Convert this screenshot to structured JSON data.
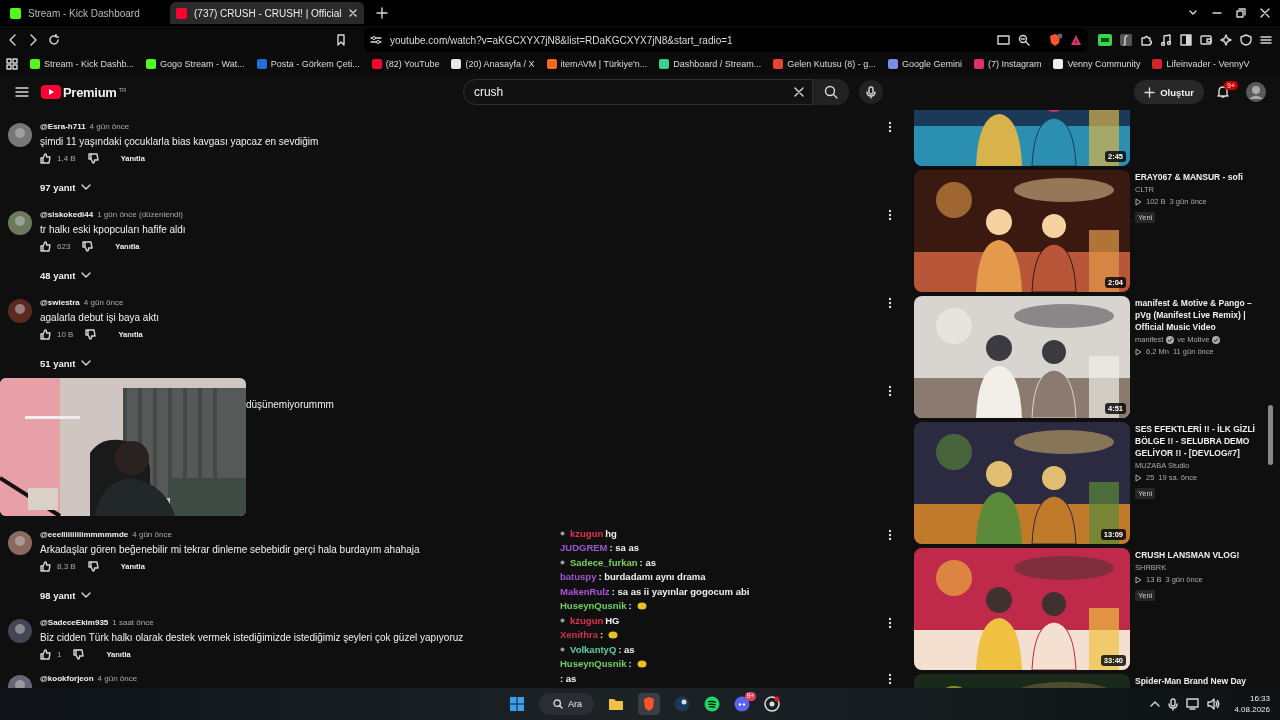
{
  "browser": {
    "tabs": [
      {
        "title": "Stream - Kick Dashboard",
        "selected": false,
        "color": "#53fc18"
      },
      {
        "title": "(737) CRUSH - CRUSH! | Official",
        "selected": true,
        "color": "#ff0033"
      }
    ],
    "url": "youtube.com/watch?v=aKGCXYX7jN8&list=RDaKGCXYX7jN8&start_radio=1",
    "bookmarks": [
      {
        "label": "Stream - Kick Dashb...",
        "color": "#53fc18"
      },
      {
        "label": "Gogo Stream - Wat...",
        "color": "#53fc18"
      },
      {
        "label": "Posta - Görkem Çeti...",
        "color": "#1e6fd9"
      },
      {
        "label": "(82) YouTube",
        "color": "#ff0033"
      },
      {
        "label": "(20) Anasayfa / X",
        "color": "#e7e7e7"
      },
      {
        "label": "itemAVM | Türkiye'n...",
        "color": "#f26a1b"
      },
      {
        "label": "Dashboard / Stream...",
        "color": "#3ccf91"
      },
      {
        "label": "Gelen Kutusu (8) - g...",
        "color": "#ea4335"
      },
      {
        "label": "Google Gemini",
        "color": "#7b8cf0"
      },
      {
        "label": "(7) Instagram",
        "color": "#e1306c"
      },
      {
        "label": "Venny Community",
        "color": "#f0f0f0"
      },
      {
        "label": "Lifeinvader - VennyV",
        "color": "#d8202a"
      }
    ]
  },
  "masthead": {
    "logo_text": "Premium",
    "region": "TR",
    "search": {
      "value": "crush"
    },
    "create": "Oluştur",
    "notifications": "9+"
  },
  "comments": [
    {
      "kind": "full",
      "author": "@Esra-h711",
      "time": "4 gün önce",
      "text": "şimdi 11 yaşındaki çocuklarla bias kavgası yapcaz en sevdiğim",
      "likes": "1,4 B",
      "reply": "Yanıtla",
      "replies": "97 yanıt"
    },
    {
      "kind": "full",
      "author": "@siskokedi44",
      "time": "1 gün önce (düzenlendi)",
      "text": "tr halkı eski kpopcuları hafife aldı",
      "likes": "623",
      "reply": "Yanıtla",
      "replies": "48 yanıt"
    },
    {
      "kind": "full",
      "author": "@swiestra",
      "time": "4 gün önce",
      "text": "agalarla debut işi baya aktı",
      "likes": "10 B",
      "reply": "Yanıtla",
      "replies": "51 yanıt"
    },
    {
      "kind": "covered",
      "text": "düşünemiyorummm"
    },
    {
      "kind": "full",
      "author": "@eeelliiiiiiiimmmmmde",
      "time": "4 gün önce",
      "text": "Arkadaşlar gören beğenebilir mi tekrar dinleme sebebidir gerçi hala burdayım ahahaja",
      "likes": "8,3 B",
      "reply": "Yanıtla",
      "replies": "98 yanıt"
    },
    {
      "kind": "full",
      "author": "@SadeceEkim935",
      "time": "1 saat önce",
      "text": "Biz cidden Türk halkı olarak destek vermek istediğimizde istediğimiz şeyleri çok güzel yapıyoruz",
      "likes": "1",
      "reply": "Yanıtla"
    },
    {
      "kind": "full",
      "author": "@kookforjeon",
      "time": "4 gün önce"
    }
  ],
  "videos": [
    {
      "duration": "2:45"
    },
    {
      "title": "ERAY067 & MANSUR - sofi",
      "channels": [
        {
          "name": "CLTR",
          "verified": false
        }
      ],
      "views": "102 B",
      "age": "3 gün önce",
      "badge": "Yeni",
      "duration": "2:04"
    },
    {
      "title": "manifest & Motive & Pango – pVg (Manifest Live Remix) | Official Music Video",
      "channels": [
        {
          "name": "manifest",
          "verified": true
        },
        {
          "name": "ve Motive",
          "verified": true
        }
      ],
      "views": "6,2 Mn",
      "age": "11 gün önce",
      "duration": "4:51"
    },
    {
      "title": "SES EFEKTLERİ !! - İLK GİZLİ BÖLGE !! -  SELUBRA DEMO GELİYOR !! -  [DEVLOG#7]",
      "channels": [
        {
          "name": "MUZABA Studio",
          "verified": false
        }
      ],
      "views": "25",
      "age": "19 sa. önce",
      "badge": "Yeni",
      "duration": "13:09"
    },
    {
      "title": "CRUSH LANSMAN VLOG!",
      "channels": [
        {
          "name": "SHRBRK",
          "verified": false
        }
      ],
      "views": "13 B",
      "age": "3 gün önce",
      "badge": "Yeni",
      "duration": "33:40"
    },
    {
      "title": "Spider-Man Brand New Day"
    }
  ],
  "chat": [
    {
      "user": "kzugun",
      "text": " hg",
      "color": "#e0304e",
      "badge": true,
      "emote": false
    },
    {
      "user": "JUDGREM",
      "text": " : sa as",
      "color": "#9b59d0",
      "badge": false,
      "emote": false
    },
    {
      "user": "Sadece_furkan",
      "text": " : as",
      "color": "#7bd35a",
      "badge": true,
      "emote": false
    },
    {
      "user": "batuspy",
      "text": " : burdadamı aynı drama",
      "color": "#9b59d0",
      "badge": false,
      "emote": false
    },
    {
      "user": "MakenRulz",
      "text": " : sa as ii yayınlar gogocum abi",
      "color": "#b14fe0",
      "badge": false,
      "emote": false
    },
    {
      "user": "HuseynQusnik",
      "text": " :",
      "color": "#6fd05a",
      "badge": false,
      "emote": true
    },
    {
      "user": "kzugun",
      "text": " HG",
      "color": "#e0304e",
      "badge": true,
      "emote": false
    },
    {
      "user": "Xenithra",
      "text": " :",
      "color": "#d0304a",
      "badge": false,
      "emote": true
    },
    {
      "user": "VolkantyQ",
      "text": " : as",
      "color": "#58d0a0",
      "badge": true,
      "emote": false
    },
    {
      "user": "HuseynQusnik",
      "text": " :",
      "color": "#6fd05a",
      "badge": false,
      "emote": true
    },
    {
      "text": ": as",
      "badge": false,
      "emote": false
    }
  ],
  "taskbar": {
    "search": "Ara",
    "chat_badge": "9+",
    "time": "16:33",
    "date": "4.08.2026"
  }
}
